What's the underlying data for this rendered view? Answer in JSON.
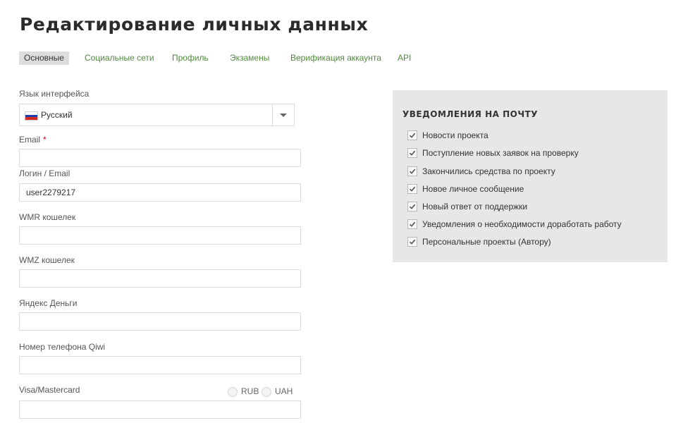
{
  "page": {
    "title": "Редактирование личных данных"
  },
  "tabs": [
    {
      "label": "Основные",
      "active": true
    },
    {
      "label": "Социальные сети",
      "active": false
    },
    {
      "label": "Профиль",
      "active": false
    },
    {
      "label": "Экзамены",
      "active": false
    },
    {
      "label": "Верификация аккаунта",
      "active": false
    },
    {
      "label": "API",
      "active": false
    }
  ],
  "form": {
    "language": {
      "label": "Язык интерфейса",
      "value": "Русский",
      "flag_colors": [
        "#ffffff",
        "#1c3fa8",
        "#d52b1e"
      ]
    },
    "email": {
      "label": "Email",
      "required_mark": "*",
      "value": ""
    },
    "login": {
      "label": "Логин / Email",
      "value": "user2279217"
    },
    "wmr": {
      "label": "WMR кошелек",
      "value": ""
    },
    "wmz": {
      "label": "WMZ кошелек",
      "value": ""
    },
    "yandex": {
      "label": "Яндекс Деньги",
      "value": ""
    },
    "qiwi": {
      "label": "Номер телефона Qiwi",
      "value": ""
    },
    "card": {
      "label": "Visa/Mastercard",
      "value": "",
      "currencies": [
        {
          "label": "RUB",
          "selected": false
        },
        {
          "label": "UAH",
          "selected": false
        }
      ]
    }
  },
  "notifications": {
    "title": "УВЕДОМЛЕНИЯ НА ПОЧТУ",
    "items": [
      {
        "label": "Новости проекта",
        "checked": true
      },
      {
        "label": "Поступление новых заявок на проверку",
        "checked": true
      },
      {
        "label": "Закончились средства по проекту",
        "checked": true
      },
      {
        "label": "Новое личное сообщение",
        "checked": true
      },
      {
        "label": "Новый ответ от поддержки",
        "checked": true
      },
      {
        "label": "Уведомления о необходимости доработать работу",
        "checked": true
      },
      {
        "label": "Персональные проекты (Автору)",
        "checked": true
      }
    ]
  },
  "colors": {
    "accent_link": "#4e8a3a",
    "required": "#d0021b",
    "panel_bg": "#e7e7e7",
    "active_tab_bg": "#dddddd"
  }
}
